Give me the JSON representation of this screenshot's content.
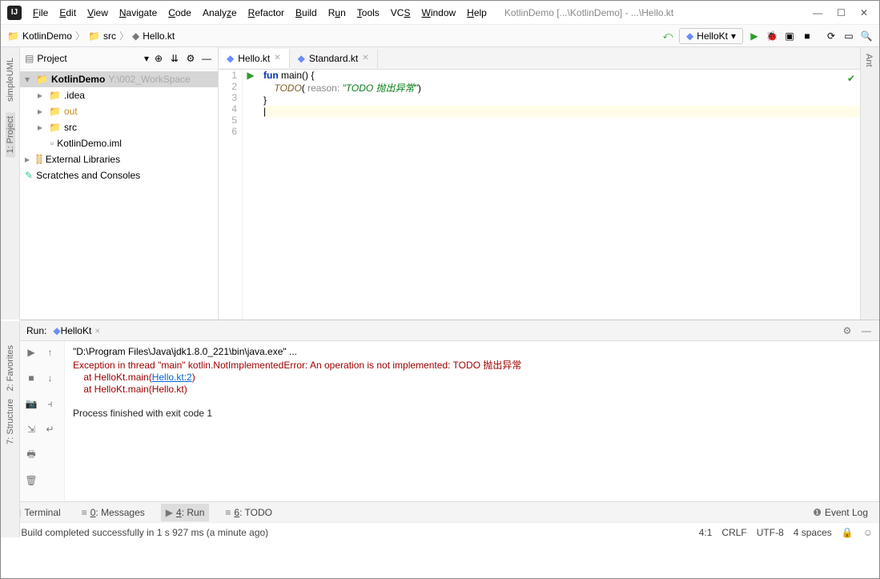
{
  "title": "KotlinDemo [...\\KotlinDemo] - ...\\Hello.kt",
  "menu": [
    "File",
    "Edit",
    "View",
    "Navigate",
    "Code",
    "Analyze",
    "Refactor",
    "Build",
    "Run",
    "Tools",
    "VCS",
    "Window",
    "Help"
  ],
  "breadcrumbs": [
    "KotlinDemo",
    "src",
    "Hello.kt"
  ],
  "run_config": "HelloKt",
  "sidebar": {
    "title": "Project",
    "tree": {
      "root": {
        "name": "KotlinDemo",
        "path": "Y:\\002_WorkSpace"
      },
      "idea": ".idea",
      "out": "out",
      "src": "src",
      "iml": "KotlinDemo.iml",
      "extlib": "External Libraries",
      "scratches": "Scratches and Consoles"
    }
  },
  "left_tools": [
    "simpleUML",
    "1: Project",
    "2: Favorites",
    "7: Structure"
  ],
  "right_tool": "Ant",
  "editor": {
    "tabs": [
      {
        "name": "Hello.kt",
        "active": true
      },
      {
        "name": "Standard.kt",
        "active": false
      }
    ],
    "lines": {
      "l1a": "fun",
      "l1b": " main() {",
      "l2a": "    ",
      "l2b": "TODO",
      "l2c": "(",
      "l2d": " reason: ",
      "l2e": "\"TODO 抛出异常\"",
      "l2f": ")",
      "l3": "}"
    }
  },
  "run": {
    "title": "Run:",
    "config": "HelloKt",
    "out1": "\"D:\\Program Files\\Java\\jdk1.8.0_221\\bin\\java.exe\" ...",
    "err1": "Exception in thread \"main\" kotlin.NotImplementedError: An operation is not implemented: TODO 抛出异常",
    "err2a": "    at HelloKt.main(",
    "err2b": "Hello.kt:2",
    "err2c": ")",
    "err3": "    at HelloKt.main(Hello.kt)",
    "proc": "Process finished with exit code 1"
  },
  "bottom": {
    "terminal": "Terminal",
    "messages": "0: Messages",
    "run": "4: Run",
    "todo": "6: TODO",
    "eventlog": "Event Log"
  },
  "status": {
    "msg": "Build completed successfully in 1 s 927 ms (a minute ago)",
    "pos": "4:1",
    "crlf": "CRLF",
    "enc": "UTF-8",
    "indent": "4 spaces"
  }
}
